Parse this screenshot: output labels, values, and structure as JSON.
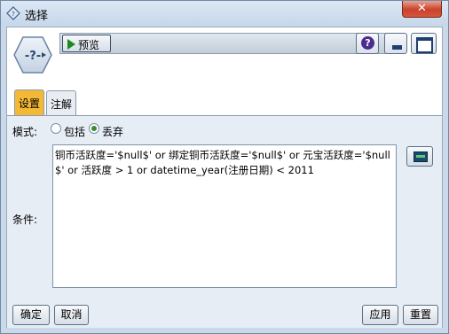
{
  "window": {
    "title": "选择",
    "close_glyph": "✕"
  },
  "toolbar": {
    "preview_label": "预览",
    "help_glyph": "?"
  },
  "tabs": [
    {
      "label": "设置",
      "active": true
    },
    {
      "label": "注解",
      "active": false
    }
  ],
  "settings": {
    "mode_label": "模式:",
    "mode_options": [
      {
        "label": "包括",
        "selected": false
      },
      {
        "label": "丢弃",
        "selected": true
      }
    ],
    "condition_label": "条件:",
    "condition_text": "铜币活跃度='$null$' or 绑定铜币活跃度='$null$' or 元宝活跃度='$null$' or 活跃度 > 1 or datetime_year(注册日期) < 2011"
  },
  "buttons": {
    "ok": "确定",
    "cancel": "取消",
    "apply": "应用",
    "reset": "重置"
  },
  "colors": {
    "active_tab": "#f3b934",
    "window_frame": "#c9d9ea",
    "close_button": "#c9422c"
  }
}
